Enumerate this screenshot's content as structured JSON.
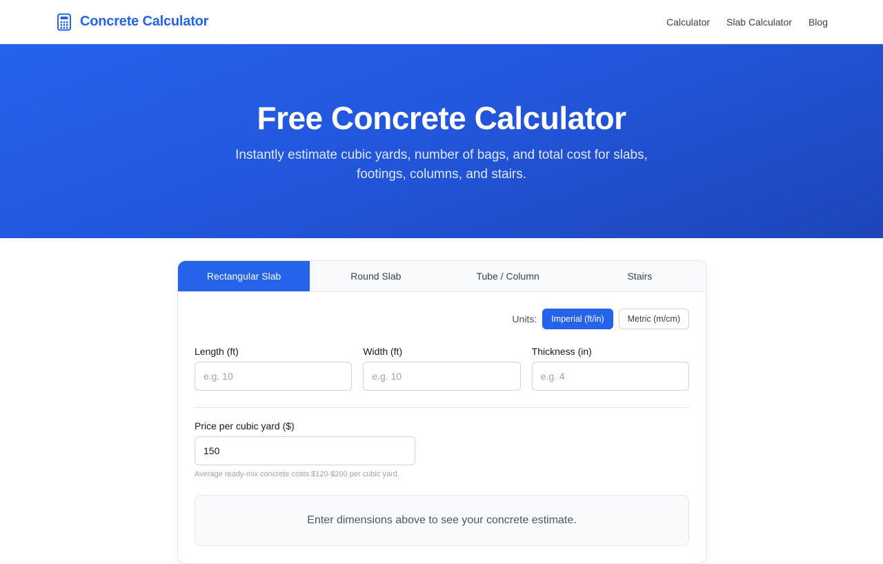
{
  "header": {
    "brand_name": "Concrete Calculator",
    "brand_icon": "calculator-icon",
    "nav": [
      {
        "label": "Calculator"
      },
      {
        "label": "Slab Calculator"
      },
      {
        "label": "Blog"
      }
    ]
  },
  "hero": {
    "title": "Free Concrete Calculator",
    "subtitle": "Instantly estimate cubic yards, number of bags, and total cost for slabs, footings, columns, and stairs."
  },
  "calculator": {
    "tabs": [
      {
        "label": "Rectangular Slab",
        "active": true
      },
      {
        "label": "Round Slab",
        "active": false
      },
      {
        "label": "Tube / Column",
        "active": false
      },
      {
        "label": "Stairs",
        "active": false
      }
    ],
    "units_label": "Units:",
    "units": [
      {
        "label": "Imperial (ft/in)",
        "active": true
      },
      {
        "label": "Metric (m/cm)",
        "active": false
      }
    ],
    "fields": [
      {
        "label": "Length (ft)",
        "placeholder": "e.g. 10",
        "value": ""
      },
      {
        "label": "Width (ft)",
        "placeholder": "e.g. 10",
        "value": ""
      },
      {
        "label": "Thickness (in)",
        "placeholder": "e.g. 4",
        "value": ""
      }
    ],
    "price": {
      "label": "Price per cubic yard ($)",
      "value": "150",
      "hint": "Average ready-mix concrete costs $120-$200 per cubic yard."
    },
    "result_message": "Enter dimensions above to see your concrete estimate."
  },
  "colors": {
    "accent": "#2563eb",
    "hero_end": "#1e45b9"
  }
}
